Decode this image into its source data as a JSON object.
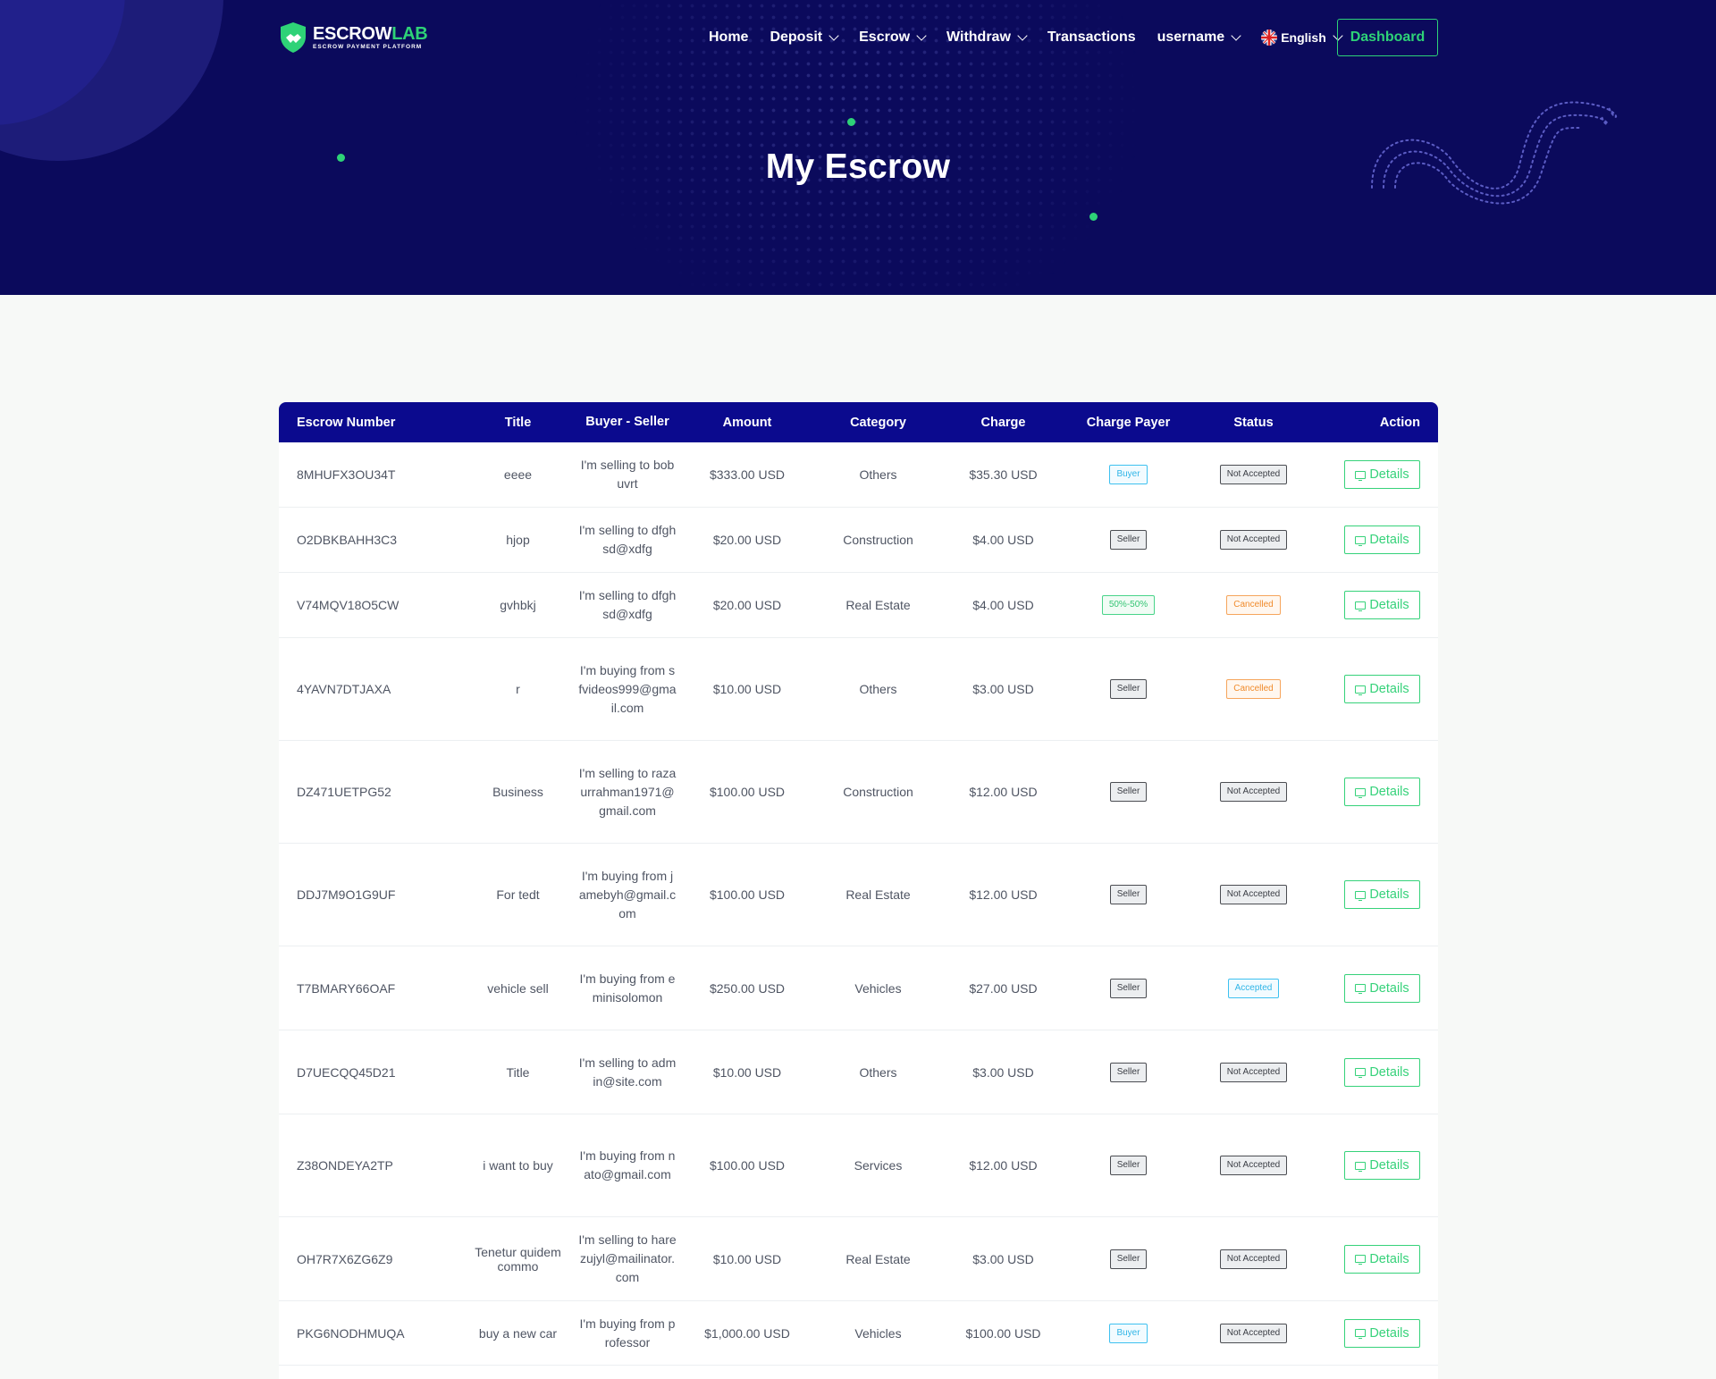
{
  "brand": {
    "name_part1": "ESCROW",
    "name_part2": "LAB",
    "tagline": "ESCROW PAYMENT PLATFORM",
    "accent_color": "#2ed277",
    "hero_color": "#0b0a5c"
  },
  "nav": {
    "home": "Home",
    "deposit": "Deposit",
    "escrow": "Escrow",
    "withdraw": "Withdraw",
    "transactions": "Transactions",
    "user": "username",
    "language": "English",
    "dashboard": "Dashboard"
  },
  "page": {
    "title": "My Escrow"
  },
  "table": {
    "header_color": "#0b0a8e",
    "columns": [
      "Escrow Number",
      "Title",
      "Buyer - Seller",
      "Amount",
      "Category",
      "Charge",
      "Charge Payer",
      "Status",
      "Action"
    ],
    "action_label": "Details",
    "rows": [
      {
        "number": "8MHUFX3OU34T",
        "title": "eeee",
        "party": "I'm selling to bobuvrt",
        "amount": "$333.00 USD",
        "category": "Others",
        "charge": "$35.30 USD",
        "payer": "Buyer",
        "status": "Not Accepted"
      },
      {
        "number": "O2DBKBAHH3C3",
        "title": "hjop",
        "party": "I'm selling to dfghsd@xdfg",
        "amount": "$20.00 USD",
        "category": "Construction",
        "charge": "$4.00 USD",
        "payer": "Seller",
        "status": "Not Accepted"
      },
      {
        "number": "V74MQV18O5CW",
        "title": "gvhbkj",
        "party": "I'm selling to dfghsd@xdfg",
        "amount": "$20.00 USD",
        "category": "Real Estate",
        "charge": "$4.00 USD",
        "payer": "50%-50%",
        "status": "Cancelled"
      },
      {
        "number": "4YAVN7DTJAXA",
        "title": "r",
        "party": "I'm buying from sfvideos999@gmail.com",
        "amount": "$10.00 USD",
        "category": "Others",
        "charge": "$3.00 USD",
        "payer": "Seller",
        "status": "Cancelled"
      },
      {
        "number": "DZ471UETPG52",
        "title": "Business",
        "party": "I'm selling to razaurrahman1971@gmail.com",
        "amount": "$100.00 USD",
        "category": "Construction",
        "charge": "$12.00 USD",
        "payer": "Seller",
        "status": "Not Accepted"
      },
      {
        "number": "DDJ7M9O1G9UF",
        "title": "For tedt",
        "party": "I'm buying from jamebyh@gmail.com",
        "amount": "$100.00 USD",
        "category": "Real Estate",
        "charge": "$12.00 USD",
        "payer": "Seller",
        "status": "Not Accepted"
      },
      {
        "number": "T7BMARY66OAF",
        "title": "vehicle sell",
        "party": "I'm buying from eminisolomon",
        "amount": "$250.00 USD",
        "category": "Vehicles",
        "charge": "$27.00 USD",
        "payer": "Seller",
        "status": "Accepted"
      },
      {
        "number": "D7UECQQ45D21",
        "title": "Title",
        "party": "I'm selling to admin@site.com",
        "amount": "$10.00 USD",
        "category": "Others",
        "charge": "$3.00 USD",
        "payer": "Seller",
        "status": "Not Accepted"
      },
      {
        "number": "Z38ONDEYA2TP",
        "title": "i want to buy",
        "party": "I'm buying from nato@gmail.com",
        "amount": "$100.00 USD",
        "category": "Services",
        "charge": "$12.00 USD",
        "payer": "Seller",
        "status": "Not Accepted"
      },
      {
        "number": "OH7R7X6ZG6Z9",
        "title": "Tenetur quidem commo",
        "party": "I'm selling to harezujyl@mailinator.com",
        "amount": "$10.00 USD",
        "category": "Real Estate",
        "charge": "$3.00 USD",
        "payer": "Seller",
        "status": "Not Accepted"
      },
      {
        "number": "PKG6NODHMUQA",
        "title": "buy a new car",
        "party": "I'm buying from professor",
        "amount": "$1,000.00 USD",
        "category": "Vehicles",
        "charge": "$100.00 USD",
        "payer": "Buyer",
        "status": "Not Accepted"
      }
    ]
  }
}
